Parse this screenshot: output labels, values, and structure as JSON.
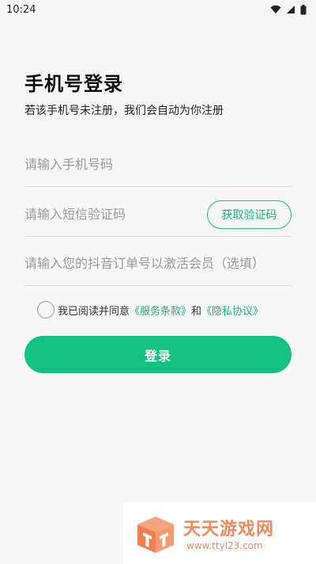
{
  "status_bar": {
    "time": "10:24",
    "icons": [
      "wifi-icon",
      "signal-icon",
      "battery-icon"
    ]
  },
  "login": {
    "title": "手机号登录",
    "subtitle": "若该手机号未注册，我们会自动为你注册",
    "phone_placeholder": "请输入手机号码",
    "code_placeholder": "请输入短信验证码",
    "code_button": "获取验证码",
    "order_placeholder": "请输入您的抖音订单号以激活会员（选填）",
    "agreement": {
      "prefix": "我已阅读并同意",
      "terms_link": "《服务条款》",
      "conjunction": "和",
      "privacy_link": "《隐私协议》",
      "checked": false
    },
    "login_button": "登录"
  },
  "watermark": {
    "name": "天天游戏网",
    "url": "www.ttyl23.com"
  },
  "colors": {
    "accent": "#13c283",
    "link": "#17b478",
    "background": "#f7f7f7",
    "watermark": "#f08a5d"
  }
}
